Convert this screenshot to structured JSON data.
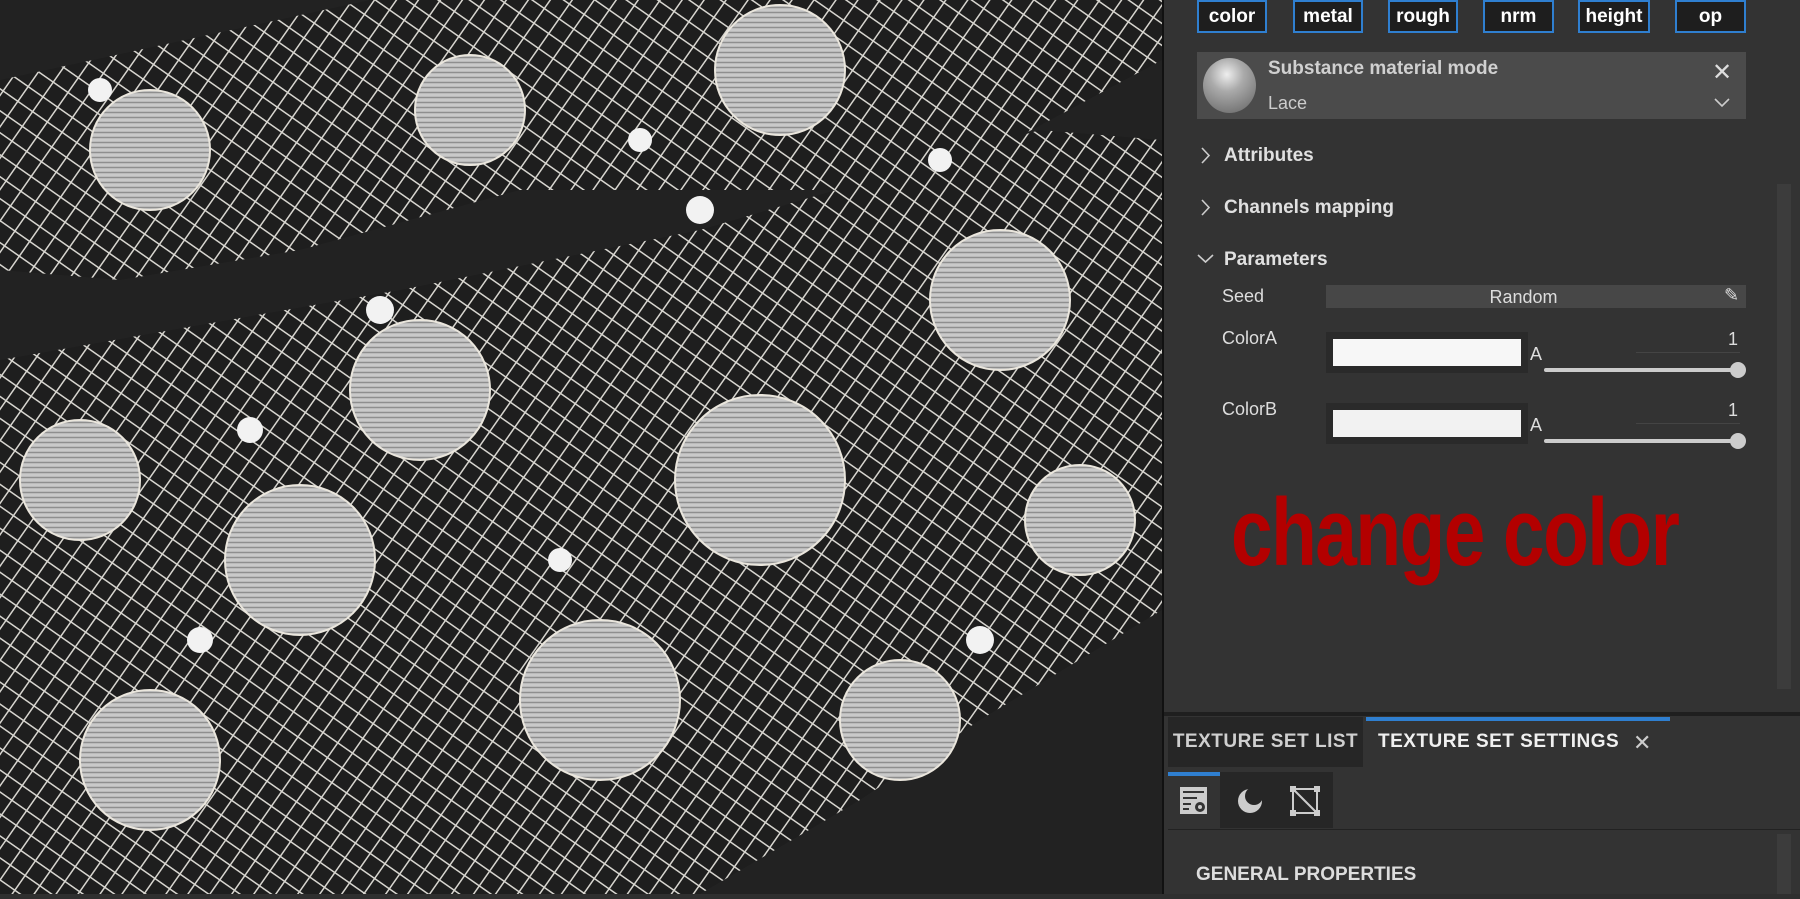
{
  "channel_chips": [
    "color",
    "metal",
    "rough",
    "nrm",
    "height",
    "op"
  ],
  "material": {
    "title": "Substance material mode",
    "value": "Lace"
  },
  "sections": {
    "attributes": "Attributes",
    "channels_mapping": "Channels mapping",
    "parameters": "Parameters"
  },
  "params": {
    "seed": {
      "label": "Seed",
      "value": "Random"
    },
    "colorA": {
      "label": "ColorA",
      "color": "#f7f7f7",
      "alpha_label": "A",
      "alpha_value": "1",
      "alpha_fraction": 1
    },
    "colorB": {
      "label": "ColorB",
      "color": "#f2f2f2",
      "alpha_label": "A",
      "alpha_value": "1",
      "alpha_fraction": 1
    }
  },
  "annotation": "change color",
  "bottom_tabs": {
    "list": "TEXTURE SET LIST",
    "settings": "TEXTURE SET SETTINGS"
  },
  "general_properties": "GENERAL PROPERTIES",
  "colors": {
    "accent": "#2f7fd0",
    "annotation": "#b30000",
    "panel": "#333333"
  }
}
